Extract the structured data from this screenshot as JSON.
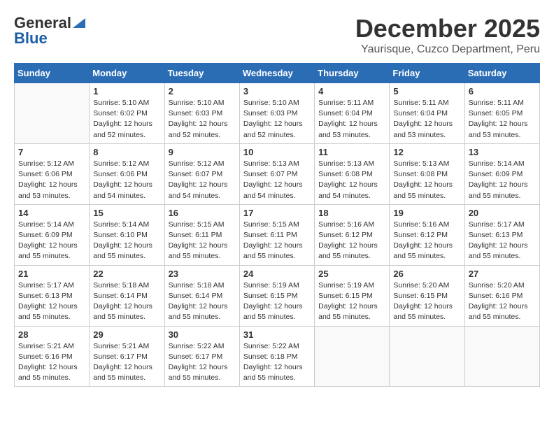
{
  "logo": {
    "general": "General",
    "blue": "Blue"
  },
  "title": "December 2025",
  "subtitle": "Yaurisque, Cuzco Department, Peru",
  "days_of_week": [
    "Sunday",
    "Monday",
    "Tuesday",
    "Wednesday",
    "Thursday",
    "Friday",
    "Saturday"
  ],
  "weeks": [
    [
      {
        "day": "",
        "info": ""
      },
      {
        "day": "1",
        "info": "Sunrise: 5:10 AM\nSunset: 6:02 PM\nDaylight: 12 hours\nand 52 minutes."
      },
      {
        "day": "2",
        "info": "Sunrise: 5:10 AM\nSunset: 6:03 PM\nDaylight: 12 hours\nand 52 minutes."
      },
      {
        "day": "3",
        "info": "Sunrise: 5:10 AM\nSunset: 6:03 PM\nDaylight: 12 hours\nand 52 minutes."
      },
      {
        "day": "4",
        "info": "Sunrise: 5:11 AM\nSunset: 6:04 PM\nDaylight: 12 hours\nand 53 minutes."
      },
      {
        "day": "5",
        "info": "Sunrise: 5:11 AM\nSunset: 6:04 PM\nDaylight: 12 hours\nand 53 minutes."
      },
      {
        "day": "6",
        "info": "Sunrise: 5:11 AM\nSunset: 6:05 PM\nDaylight: 12 hours\nand 53 minutes."
      }
    ],
    [
      {
        "day": "7",
        "info": "Sunrise: 5:12 AM\nSunset: 6:06 PM\nDaylight: 12 hours\nand 53 minutes."
      },
      {
        "day": "8",
        "info": "Sunrise: 5:12 AM\nSunset: 6:06 PM\nDaylight: 12 hours\nand 54 minutes."
      },
      {
        "day": "9",
        "info": "Sunrise: 5:12 AM\nSunset: 6:07 PM\nDaylight: 12 hours\nand 54 minutes."
      },
      {
        "day": "10",
        "info": "Sunrise: 5:13 AM\nSunset: 6:07 PM\nDaylight: 12 hours\nand 54 minutes."
      },
      {
        "day": "11",
        "info": "Sunrise: 5:13 AM\nSunset: 6:08 PM\nDaylight: 12 hours\nand 54 minutes."
      },
      {
        "day": "12",
        "info": "Sunrise: 5:13 AM\nSunset: 6:08 PM\nDaylight: 12 hours\nand 55 minutes."
      },
      {
        "day": "13",
        "info": "Sunrise: 5:14 AM\nSunset: 6:09 PM\nDaylight: 12 hours\nand 55 minutes."
      }
    ],
    [
      {
        "day": "14",
        "info": "Sunrise: 5:14 AM\nSunset: 6:09 PM\nDaylight: 12 hours\nand 55 minutes."
      },
      {
        "day": "15",
        "info": "Sunrise: 5:14 AM\nSunset: 6:10 PM\nDaylight: 12 hours\nand 55 minutes."
      },
      {
        "day": "16",
        "info": "Sunrise: 5:15 AM\nSunset: 6:11 PM\nDaylight: 12 hours\nand 55 minutes."
      },
      {
        "day": "17",
        "info": "Sunrise: 5:15 AM\nSunset: 6:11 PM\nDaylight: 12 hours\nand 55 minutes."
      },
      {
        "day": "18",
        "info": "Sunrise: 5:16 AM\nSunset: 6:12 PM\nDaylight: 12 hours\nand 55 minutes."
      },
      {
        "day": "19",
        "info": "Sunrise: 5:16 AM\nSunset: 6:12 PM\nDaylight: 12 hours\nand 55 minutes."
      },
      {
        "day": "20",
        "info": "Sunrise: 5:17 AM\nSunset: 6:13 PM\nDaylight: 12 hours\nand 55 minutes."
      }
    ],
    [
      {
        "day": "21",
        "info": "Sunrise: 5:17 AM\nSunset: 6:13 PM\nDaylight: 12 hours\nand 55 minutes."
      },
      {
        "day": "22",
        "info": "Sunrise: 5:18 AM\nSunset: 6:14 PM\nDaylight: 12 hours\nand 55 minutes."
      },
      {
        "day": "23",
        "info": "Sunrise: 5:18 AM\nSunset: 6:14 PM\nDaylight: 12 hours\nand 55 minutes."
      },
      {
        "day": "24",
        "info": "Sunrise: 5:19 AM\nSunset: 6:15 PM\nDaylight: 12 hours\nand 55 minutes."
      },
      {
        "day": "25",
        "info": "Sunrise: 5:19 AM\nSunset: 6:15 PM\nDaylight: 12 hours\nand 55 minutes."
      },
      {
        "day": "26",
        "info": "Sunrise: 5:20 AM\nSunset: 6:15 PM\nDaylight: 12 hours\nand 55 minutes."
      },
      {
        "day": "27",
        "info": "Sunrise: 5:20 AM\nSunset: 6:16 PM\nDaylight: 12 hours\nand 55 minutes."
      }
    ],
    [
      {
        "day": "28",
        "info": "Sunrise: 5:21 AM\nSunset: 6:16 PM\nDaylight: 12 hours\nand 55 minutes."
      },
      {
        "day": "29",
        "info": "Sunrise: 5:21 AM\nSunset: 6:17 PM\nDaylight: 12 hours\nand 55 minutes."
      },
      {
        "day": "30",
        "info": "Sunrise: 5:22 AM\nSunset: 6:17 PM\nDaylight: 12 hours\nand 55 minutes."
      },
      {
        "day": "31",
        "info": "Sunrise: 5:22 AM\nSunset: 6:18 PM\nDaylight: 12 hours\nand 55 minutes."
      },
      {
        "day": "",
        "info": ""
      },
      {
        "day": "",
        "info": ""
      },
      {
        "day": "",
        "info": ""
      }
    ]
  ]
}
